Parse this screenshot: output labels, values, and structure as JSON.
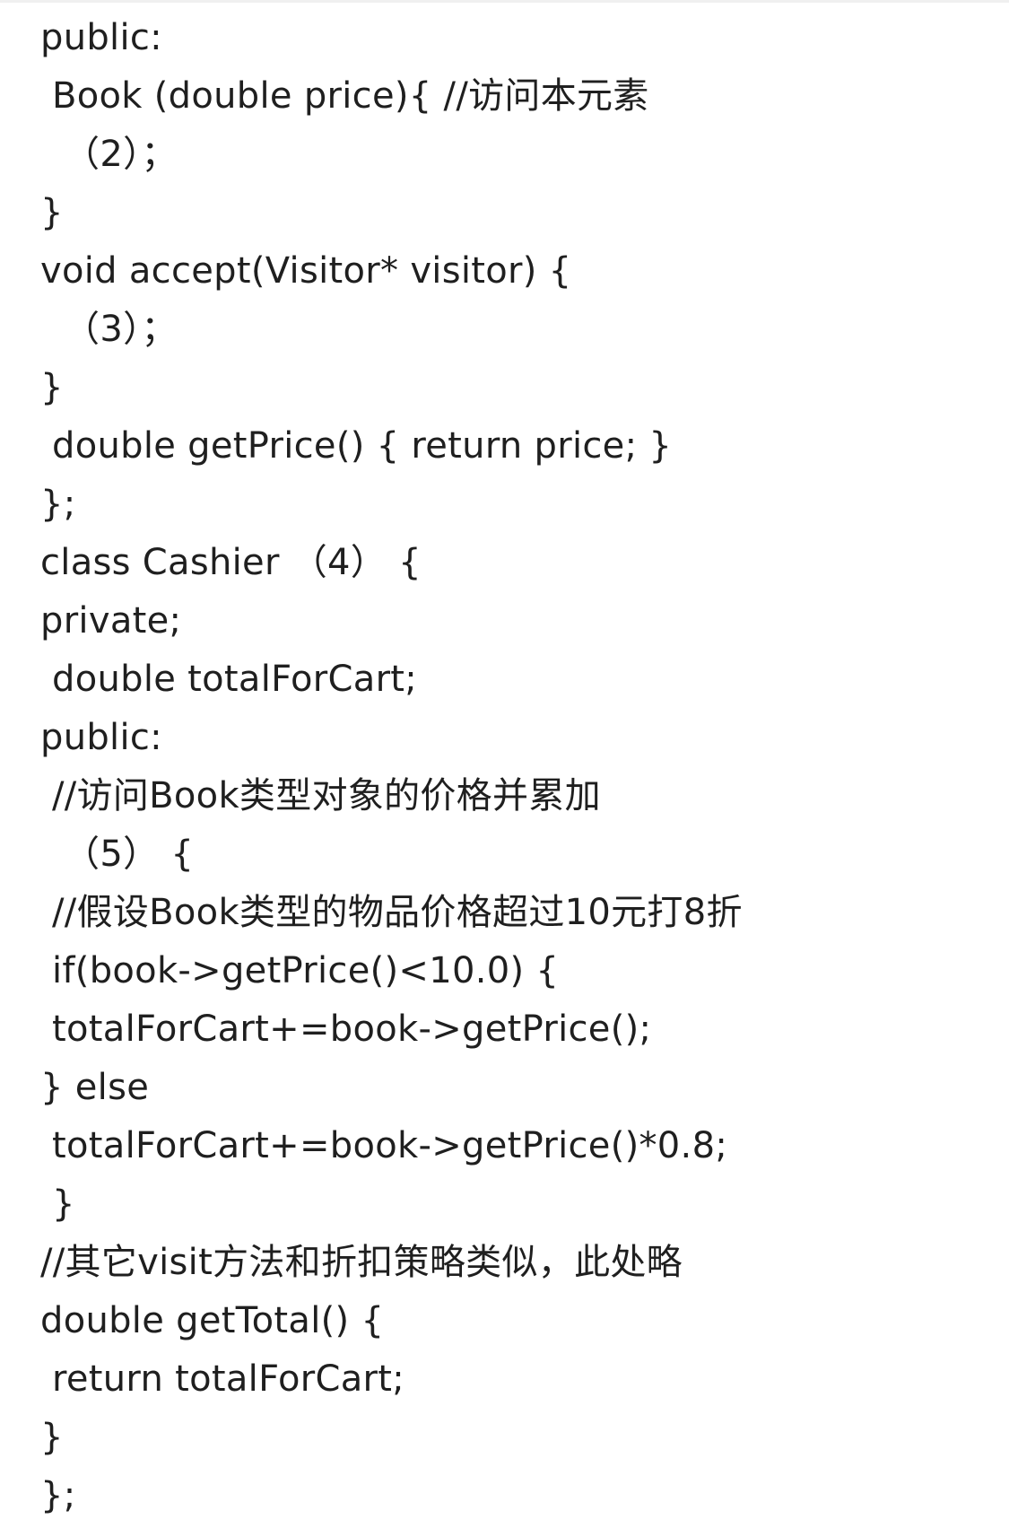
{
  "document": {
    "lines": [
      "public:",
      " Book (double price){ //访问本元素",
      "  （2）；",
      "}",
      "void accept(Visitor* visitor) {",
      "  （3）；",
      "}",
      " double getPrice() { return price; }",
      "};",
      "class Cashier （4） {",
      "private;",
      " double totalForCart;",
      "public:",
      " //访问Book类型对象的价格并累加",
      "  （5） {",
      " //假设Book类型的物品价格超过10元打8折",
      " if(book->getPrice()<10.0) {",
      " totalForCart+=book->getPrice();",
      "} else",
      " totalForCart+=book->getPrice()*0.8;",
      " }",
      "//其它visit方法和折扣策略类似，此处略",
      "double getTotal() {",
      " return totalForCart;",
      "}",
      "};"
    ]
  }
}
